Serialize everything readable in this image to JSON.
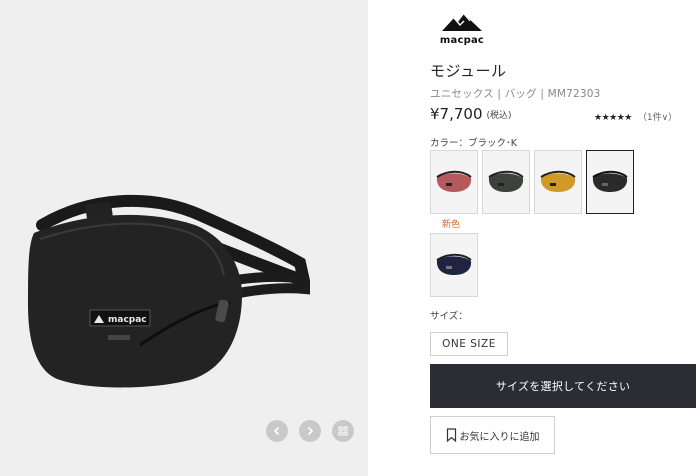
{
  "brand": {
    "logo_text": "macpac"
  },
  "product": {
    "name": "モジュール",
    "subtitle": "ユニセックス | バッグ | MM72303",
    "price": "¥7,700",
    "tax_note": "(税込)",
    "rating_stars": "★★★★★",
    "rating_count": "（1件∨）",
    "bag_logo": "macpac"
  },
  "color": {
    "label": "カラー：ブラック･K",
    "new_label": "新色",
    "swatches": [
      {
        "name": "red",
        "color": "#b45a5e"
      },
      {
        "name": "dark-green",
        "color": "#3e423e"
      },
      {
        "name": "mustard",
        "color": "#cf9a26"
      },
      {
        "name": "black",
        "color": "#2a2a2a",
        "selected": true
      },
      {
        "name": "navy",
        "color": "#1f2540"
      }
    ]
  },
  "size": {
    "label": "サイズ：",
    "option": "ONE SIZE"
  },
  "actions": {
    "select_size": "サイズを選択してください",
    "favorite": "お気に入りに追加"
  },
  "gallery": {
    "controls": [
      "chevron-left-icon",
      "chevron-right-icon",
      "grid-icon"
    ]
  }
}
